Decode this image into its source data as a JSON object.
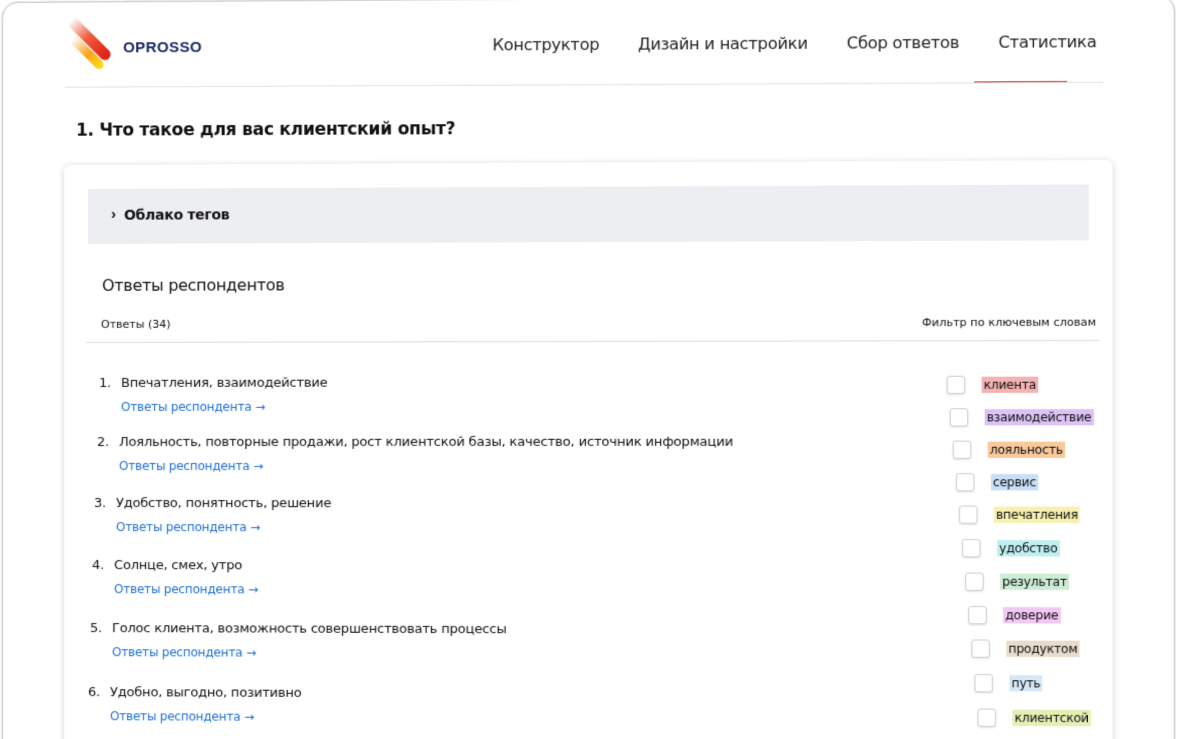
{
  "brand": {
    "name": "OPROSSO"
  },
  "nav": {
    "items": [
      {
        "label": "Конструктор"
      },
      {
        "label": "Дизайн и настройки"
      },
      {
        "label": "Сбор ответов"
      },
      {
        "label": "Статистика",
        "active": true
      }
    ]
  },
  "question": {
    "title": "1. Что такое для вас клиентский опыт?"
  },
  "tag_cloud": {
    "label": "Облако тегов",
    "chevron": "›"
  },
  "answers": {
    "title": "Ответы респондентов",
    "count_label": "Ответы (34)",
    "filter_label": "Фильтр по ключевым словам",
    "link_label": "Ответы респондента →",
    "items": [
      {
        "num": "1.",
        "text": "Впечатления, взаимодействие"
      },
      {
        "num": "2.",
        "text": "Лояльность, повторные продажи, рост клиентской базы, качество, источник информации"
      },
      {
        "num": "3.",
        "text": "Удобство, понятность, решение"
      },
      {
        "num": "4.",
        "text": "Солнце, смех, утро"
      },
      {
        "num": "5.",
        "text": "Голос клиента, возможность совершенствовать процессы"
      },
      {
        "num": "6.",
        "text": "Удобно, выгодно, позитивно"
      }
    ]
  },
  "keywords": [
    {
      "label": "клиента",
      "color": "#f4b3b3"
    },
    {
      "label": "взаимодействие",
      "color": "#dcc3f5"
    },
    {
      "label": "лояльность",
      "color": "#f8c99b"
    },
    {
      "label": "сервис",
      "color": "#c7dff7"
    },
    {
      "label": "впечатления",
      "color": "#f7f0b0"
    },
    {
      "label": "удобство",
      "color": "#bfeff0"
    },
    {
      "label": "результат",
      "color": "#cdecd4"
    },
    {
      "label": "доверие",
      "color": "#f3c7f4"
    },
    {
      "label": "продуктом",
      "color": "#e8dccd"
    },
    {
      "label": "путь",
      "color": "#d6e8f8"
    },
    {
      "label": "клиентской",
      "color": "#e4efb4"
    }
  ]
}
